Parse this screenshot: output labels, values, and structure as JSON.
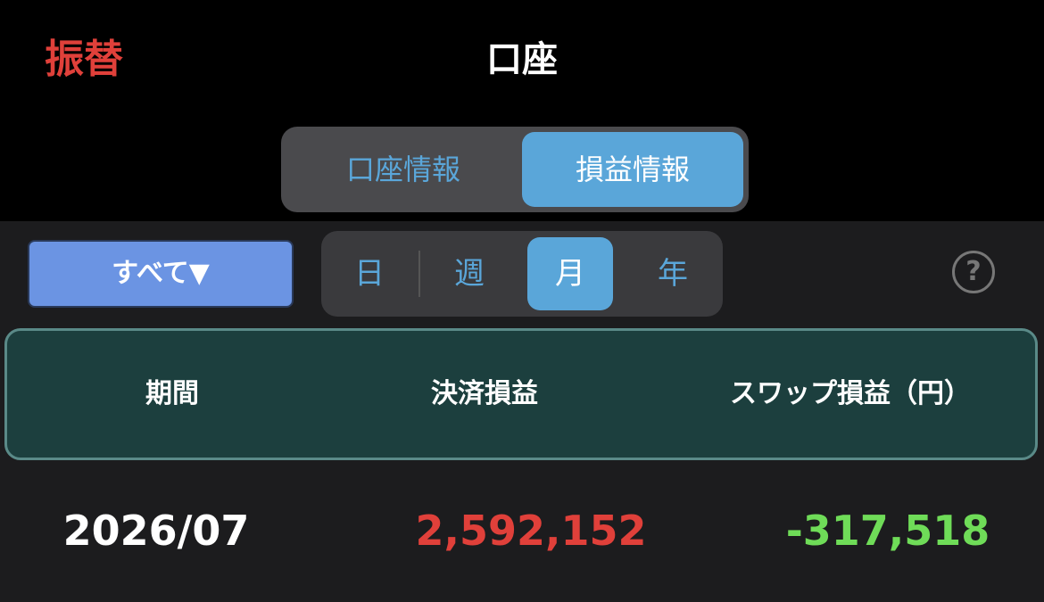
{
  "header": {
    "transfer_label": "振替",
    "title": "口座"
  },
  "top_tabs": [
    {
      "label": "口座情報",
      "selected": false
    },
    {
      "label": "損益情報",
      "selected": true
    }
  ],
  "filter": {
    "label": "すべて▼"
  },
  "period_tabs": [
    {
      "label": "日",
      "selected": false
    },
    {
      "label": "週",
      "selected": false
    },
    {
      "label": "月",
      "selected": true
    },
    {
      "label": "年",
      "selected": false
    }
  ],
  "help": {
    "glyph": "?"
  },
  "table": {
    "headers": [
      "期間",
      "決済損益",
      "スワップ損益（円）"
    ],
    "rows": [
      {
        "period": "2026/07",
        "settlement_pl": "2,592,152",
        "swap_pl": "-317,518"
      }
    ]
  },
  "colors": {
    "accent_blue": "#5aa6d9",
    "profit_red": "#e0403a",
    "loss_green": "#6fdc58",
    "filter_button": "#6b94e3",
    "table_header_bg": "#1c3f3e"
  }
}
